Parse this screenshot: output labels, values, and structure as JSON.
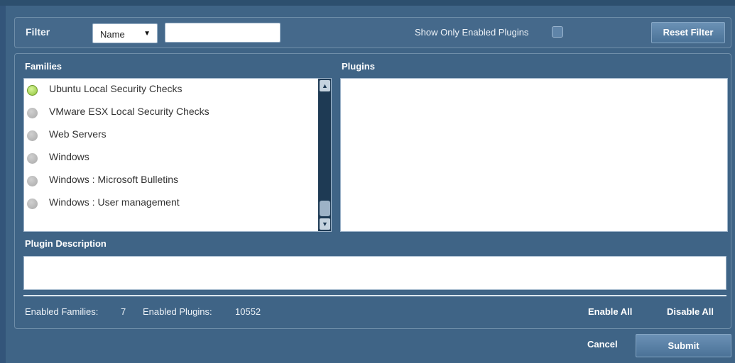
{
  "filter": {
    "label": "Filter",
    "select_value": "Name",
    "input_value": "",
    "show_only_label": "Show Only Enabled Plugins",
    "show_only_checked": false,
    "reset_label": "Reset Filter"
  },
  "families": {
    "title": "Families",
    "items": [
      {
        "label": "Ubuntu Local Security Checks",
        "enabled": true
      },
      {
        "label": "VMware ESX Local Security Checks",
        "enabled": false
      },
      {
        "label": "Web Servers",
        "enabled": false
      },
      {
        "label": "Windows",
        "enabled": false
      },
      {
        "label": "Windows : Microsoft Bulletins",
        "enabled": false
      },
      {
        "label": "Windows : User management",
        "enabled": false
      }
    ]
  },
  "plugins": {
    "title": "Plugins",
    "items": []
  },
  "description": {
    "title": "Plugin Description",
    "text": ""
  },
  "footer": {
    "enabled_families_label": "Enabled Families:",
    "enabled_families_value": "7",
    "enabled_plugins_label": "Enabled Plugins:",
    "enabled_plugins_value": "10552",
    "enable_all": "Enable All",
    "disable_all": "Disable All"
  },
  "actions": {
    "cancel": "Cancel",
    "submit": "Submit"
  },
  "icons": {
    "dropdown": "chevron-down-icon",
    "scroll_up": "arrow-up-icon",
    "scroll_down": "arrow-down-icon",
    "enabled_dot": "status-dot-icon"
  },
  "colors": {
    "background": "#3f6486",
    "enabled_dot": "#8fc43a",
    "disabled_dot": "#a9a9a9"
  }
}
